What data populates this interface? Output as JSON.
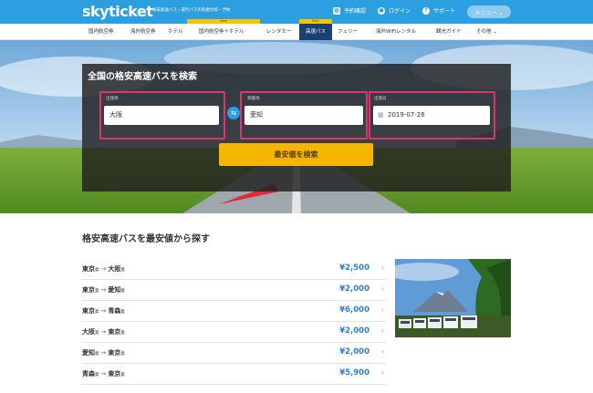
{
  "header": {
    "logo": "skyticket",
    "tagline": "格安高速バス・夜行バスの料金比較・予約",
    "links": [
      {
        "icon": "calendar-icon",
        "label": "予約確認"
      },
      {
        "icon": "user-icon",
        "label": "ログイン"
      },
      {
        "icon": "question-icon",
        "label": "サポート"
      }
    ],
    "menu_label": "メニュー ⌄"
  },
  "nav": {
    "items": [
      "国内航空券",
      "海外航空券",
      "ホテル",
      "国内航空券＋ホテル",
      "レンタカー",
      "高速バス",
      "フェリー",
      "海外WiFiレンタル",
      "観光ガイド",
      "その他 ⌄"
    ],
    "new_tag": "New"
  },
  "search": {
    "title": "全国の格安高速バスを検索",
    "departure": {
      "label": "出発地",
      "value": "大阪"
    },
    "arrival": {
      "label": "到着地",
      "value": "愛知"
    },
    "date": {
      "label": "出発日",
      "value": "2019-07-26"
    },
    "swap_glyph": "⇆",
    "submit_label": "最安値を検索"
  },
  "routes": {
    "title": "格安高速バスを最安値から探す",
    "from_suffix": "発",
    "to_suffix": "着",
    "items": [
      {
        "from": "東京",
        "to": "大阪",
        "price": "¥2,500"
      },
      {
        "from": "東京",
        "to": "愛知",
        "price": "¥2,000"
      },
      {
        "from": "東京",
        "to": "青森",
        "price": "¥6,000"
      },
      {
        "from": "大阪",
        "to": "東京",
        "price": "¥2,000"
      },
      {
        "from": "愛知",
        "to": "東京",
        "price": "¥2,000"
      },
      {
        "from": "青森",
        "to": "東京",
        "price": "¥5,900"
      }
    ]
  },
  "colors": {
    "header_blue": "#2b9fe0",
    "active_nav": "#1b3f73",
    "highlight_pink": "#e0346f",
    "button_yellow": "#f6b500",
    "price_blue": "#2b7fd0"
  }
}
